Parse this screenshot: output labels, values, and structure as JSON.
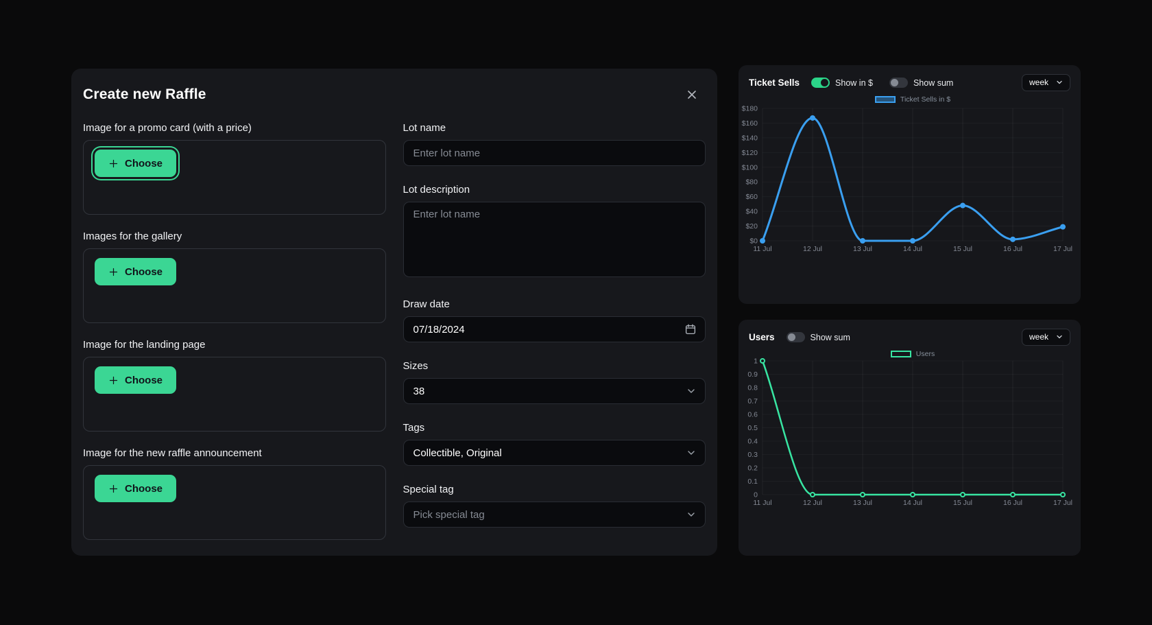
{
  "modal": {
    "title": "Create new Raffle",
    "choose_button_label": "Choose",
    "uploads": [
      {
        "label": "Image for a promo card (with a price)"
      },
      {
        "label": "Images for the gallery"
      },
      {
        "label": "Image for the landing page"
      },
      {
        "label": "Image for the new raffle announcement"
      }
    ],
    "fields": {
      "lot_name": {
        "label": "Lot name",
        "placeholder": "Enter lot name"
      },
      "lot_description": {
        "label": "Lot description",
        "placeholder": "Enter lot name"
      },
      "draw_date": {
        "label": "Draw date",
        "value": "07/18/2024"
      },
      "sizes": {
        "label": "Sizes",
        "value": "38"
      },
      "tags": {
        "label": "Tags",
        "value": "Collectible, Original"
      },
      "special_tag": {
        "label": "Special tag",
        "placeholder": "Pick special tag"
      }
    }
  },
  "panels": [
    {
      "title": "Ticket Sells",
      "toggles": [
        {
          "label": "Show in $",
          "on": true
        },
        {
          "label": "Show sum",
          "on": false
        }
      ],
      "range": "week"
    },
    {
      "title": "Users",
      "toggles": [
        {
          "label": "Show sum",
          "on": false
        }
      ],
      "range": "week"
    }
  ],
  "colors": {
    "accent_green": "#3bd694",
    "toggle_on_green": "#2bd488",
    "line_blue": "#3a9ff0",
    "line_green": "#38e5a2"
  },
  "chart_data": [
    {
      "type": "line",
      "title": "Ticket Sells",
      "categories": [
        "11 Jul",
        "12 Jul",
        "13 Jul",
        "14 Jul",
        "15 Jul",
        "16 Jul",
        "17 Jul"
      ],
      "series": [
        {
          "name": "Ticket Sells in $",
          "values": [
            0,
            167,
            0,
            0,
            48,
            2,
            19
          ],
          "color": "#3a9ff0",
          "legend_fill": "rgba(58,159,240,0.45)",
          "point_style": "solid",
          "line_width": 3
        }
      ],
      "xlabel": "",
      "ylabel": "",
      "ylim": [
        0,
        180
      ],
      "ytick_step": 20,
      "ytick_prefix": "$",
      "grid": true,
      "legend_position": "top",
      "interpolation": "monotone"
    },
    {
      "type": "line",
      "title": "Users",
      "categories": [
        "11 Jul",
        "12 Jul",
        "13 Jul",
        "14 Jul",
        "15 Jul",
        "16 Jul",
        "17 Jul"
      ],
      "series": [
        {
          "name": "Users",
          "values": [
            1,
            0,
            0,
            0,
            0,
            0,
            0
          ],
          "color": "#38e5a2",
          "legend_fill": "transparent",
          "point_style": "hollow",
          "line_width": 2.5
        }
      ],
      "xlabel": "",
      "ylabel": "",
      "ylim": [
        0,
        1
      ],
      "ytick_step": 0.1,
      "ytick_prefix": "",
      "grid": true,
      "legend_position": "top",
      "interpolation": "monotone"
    }
  ]
}
